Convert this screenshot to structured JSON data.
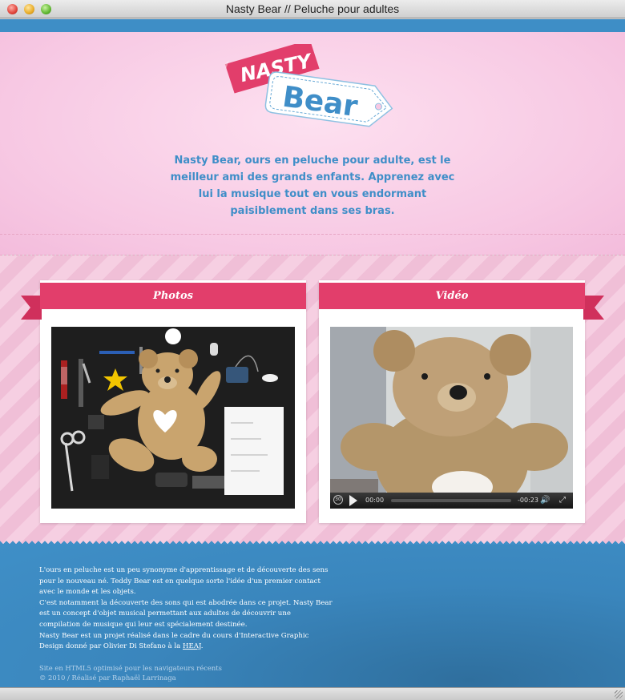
{
  "window": {
    "title": "Nasty Bear // Peluche pour adultes"
  },
  "logo": {
    "word1": "NASTY",
    "word2": "Bear"
  },
  "header": {
    "tagline": "Nasty Bear, ours en peluche pour adulte, est le meilleur ami des grands enfants. Apprenez avec lui la musique tout en vous endormant paisiblement dans ses bras."
  },
  "sections": {
    "photos_label": "Photos",
    "video_label": "Vidéo"
  },
  "video": {
    "time_elapsed": "00:00",
    "time_remaining": "-00:23",
    "skip_back": "30"
  },
  "footer": {
    "paragraph1": "L'ours en peluche est un peu synonyme d'apprentissage et de découverte des sens pour le nouveau né. Teddy Bear est en quelque sorte l'idée d'un premier contact avec le monde et les objets.",
    "paragraph2": "C'est notamment la découverte des sons qui est abodrée dans ce projet. Nasty Bear est un concept d'objet musical permettant aux adultes de découvrir une compilation de musique qui leur est spécialement destinée.",
    "paragraph3_prefix": "Nasty Bear est un projet réalisé dans le cadre du cours d'Interactive Graphic Design donné par Olivier Di Stefano à la ",
    "paragraph3_link": "HEAJ",
    "paragraph3_suffix": ".",
    "credit_line1": "Site en HTML5 optimisé pour les navigateurs récents",
    "credit_line2": "© 2010 / Réalisé par Raphaël Larrinaga"
  },
  "colors": {
    "brand_pink": "#e23e6b",
    "brand_blue": "#3f8ec8",
    "background_pink": "#f7c8e3"
  }
}
